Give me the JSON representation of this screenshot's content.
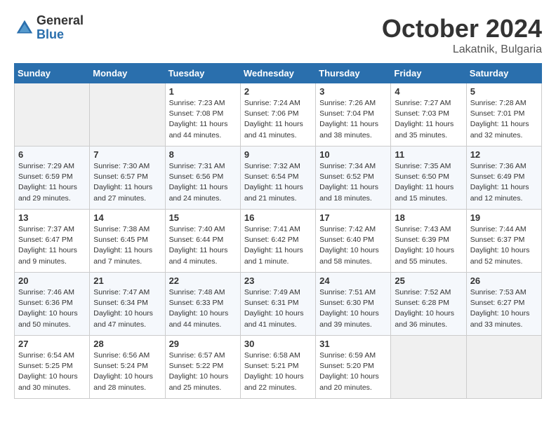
{
  "header": {
    "logo_general": "General",
    "logo_blue": "Blue",
    "month": "October 2024",
    "location": "Lakatnik, Bulgaria"
  },
  "days_of_week": [
    "Sunday",
    "Monday",
    "Tuesday",
    "Wednesday",
    "Thursday",
    "Friday",
    "Saturday"
  ],
  "weeks": [
    [
      {
        "num": "",
        "empty": true
      },
      {
        "num": "",
        "empty": true
      },
      {
        "num": "1",
        "sunrise": "7:23 AM",
        "sunset": "7:08 PM",
        "daylight": "11 hours and 44 minutes."
      },
      {
        "num": "2",
        "sunrise": "7:24 AM",
        "sunset": "7:06 PM",
        "daylight": "11 hours and 41 minutes."
      },
      {
        "num": "3",
        "sunrise": "7:26 AM",
        "sunset": "7:04 PM",
        "daylight": "11 hours and 38 minutes."
      },
      {
        "num": "4",
        "sunrise": "7:27 AM",
        "sunset": "7:03 PM",
        "daylight": "11 hours and 35 minutes."
      },
      {
        "num": "5",
        "sunrise": "7:28 AM",
        "sunset": "7:01 PM",
        "daylight": "11 hours and 32 minutes."
      }
    ],
    [
      {
        "num": "6",
        "sunrise": "7:29 AM",
        "sunset": "6:59 PM",
        "daylight": "11 hours and 29 minutes."
      },
      {
        "num": "7",
        "sunrise": "7:30 AM",
        "sunset": "6:57 PM",
        "daylight": "11 hours and 27 minutes."
      },
      {
        "num": "8",
        "sunrise": "7:31 AM",
        "sunset": "6:56 PM",
        "daylight": "11 hours and 24 minutes."
      },
      {
        "num": "9",
        "sunrise": "7:32 AM",
        "sunset": "6:54 PM",
        "daylight": "11 hours and 21 minutes."
      },
      {
        "num": "10",
        "sunrise": "7:34 AM",
        "sunset": "6:52 PM",
        "daylight": "11 hours and 18 minutes."
      },
      {
        "num": "11",
        "sunrise": "7:35 AM",
        "sunset": "6:50 PM",
        "daylight": "11 hours and 15 minutes."
      },
      {
        "num": "12",
        "sunrise": "7:36 AM",
        "sunset": "6:49 PM",
        "daylight": "11 hours and 12 minutes."
      }
    ],
    [
      {
        "num": "13",
        "sunrise": "7:37 AM",
        "sunset": "6:47 PM",
        "daylight": "11 hours and 9 minutes."
      },
      {
        "num": "14",
        "sunrise": "7:38 AM",
        "sunset": "6:45 PM",
        "daylight": "11 hours and 7 minutes."
      },
      {
        "num": "15",
        "sunrise": "7:40 AM",
        "sunset": "6:44 PM",
        "daylight": "11 hours and 4 minutes."
      },
      {
        "num": "16",
        "sunrise": "7:41 AM",
        "sunset": "6:42 PM",
        "daylight": "11 hours and 1 minute."
      },
      {
        "num": "17",
        "sunrise": "7:42 AM",
        "sunset": "6:40 PM",
        "daylight": "10 hours and 58 minutes."
      },
      {
        "num": "18",
        "sunrise": "7:43 AM",
        "sunset": "6:39 PM",
        "daylight": "10 hours and 55 minutes."
      },
      {
        "num": "19",
        "sunrise": "7:44 AM",
        "sunset": "6:37 PM",
        "daylight": "10 hours and 52 minutes."
      }
    ],
    [
      {
        "num": "20",
        "sunrise": "7:46 AM",
        "sunset": "6:36 PM",
        "daylight": "10 hours and 50 minutes."
      },
      {
        "num": "21",
        "sunrise": "7:47 AM",
        "sunset": "6:34 PM",
        "daylight": "10 hours and 47 minutes."
      },
      {
        "num": "22",
        "sunrise": "7:48 AM",
        "sunset": "6:33 PM",
        "daylight": "10 hours and 44 minutes."
      },
      {
        "num": "23",
        "sunrise": "7:49 AM",
        "sunset": "6:31 PM",
        "daylight": "10 hours and 41 minutes."
      },
      {
        "num": "24",
        "sunrise": "7:51 AM",
        "sunset": "6:30 PM",
        "daylight": "10 hours and 39 minutes."
      },
      {
        "num": "25",
        "sunrise": "7:52 AM",
        "sunset": "6:28 PM",
        "daylight": "10 hours and 36 minutes."
      },
      {
        "num": "26",
        "sunrise": "7:53 AM",
        "sunset": "6:27 PM",
        "daylight": "10 hours and 33 minutes."
      }
    ],
    [
      {
        "num": "27",
        "sunrise": "6:54 AM",
        "sunset": "5:25 PM",
        "daylight": "10 hours and 30 minutes."
      },
      {
        "num": "28",
        "sunrise": "6:56 AM",
        "sunset": "5:24 PM",
        "daylight": "10 hours and 28 minutes."
      },
      {
        "num": "29",
        "sunrise": "6:57 AM",
        "sunset": "5:22 PM",
        "daylight": "10 hours and 25 minutes."
      },
      {
        "num": "30",
        "sunrise": "6:58 AM",
        "sunset": "5:21 PM",
        "daylight": "10 hours and 22 minutes."
      },
      {
        "num": "31",
        "sunrise": "6:59 AM",
        "sunset": "5:20 PM",
        "daylight": "10 hours and 20 minutes."
      },
      {
        "num": "",
        "empty": true
      },
      {
        "num": "",
        "empty": true
      }
    ]
  ]
}
